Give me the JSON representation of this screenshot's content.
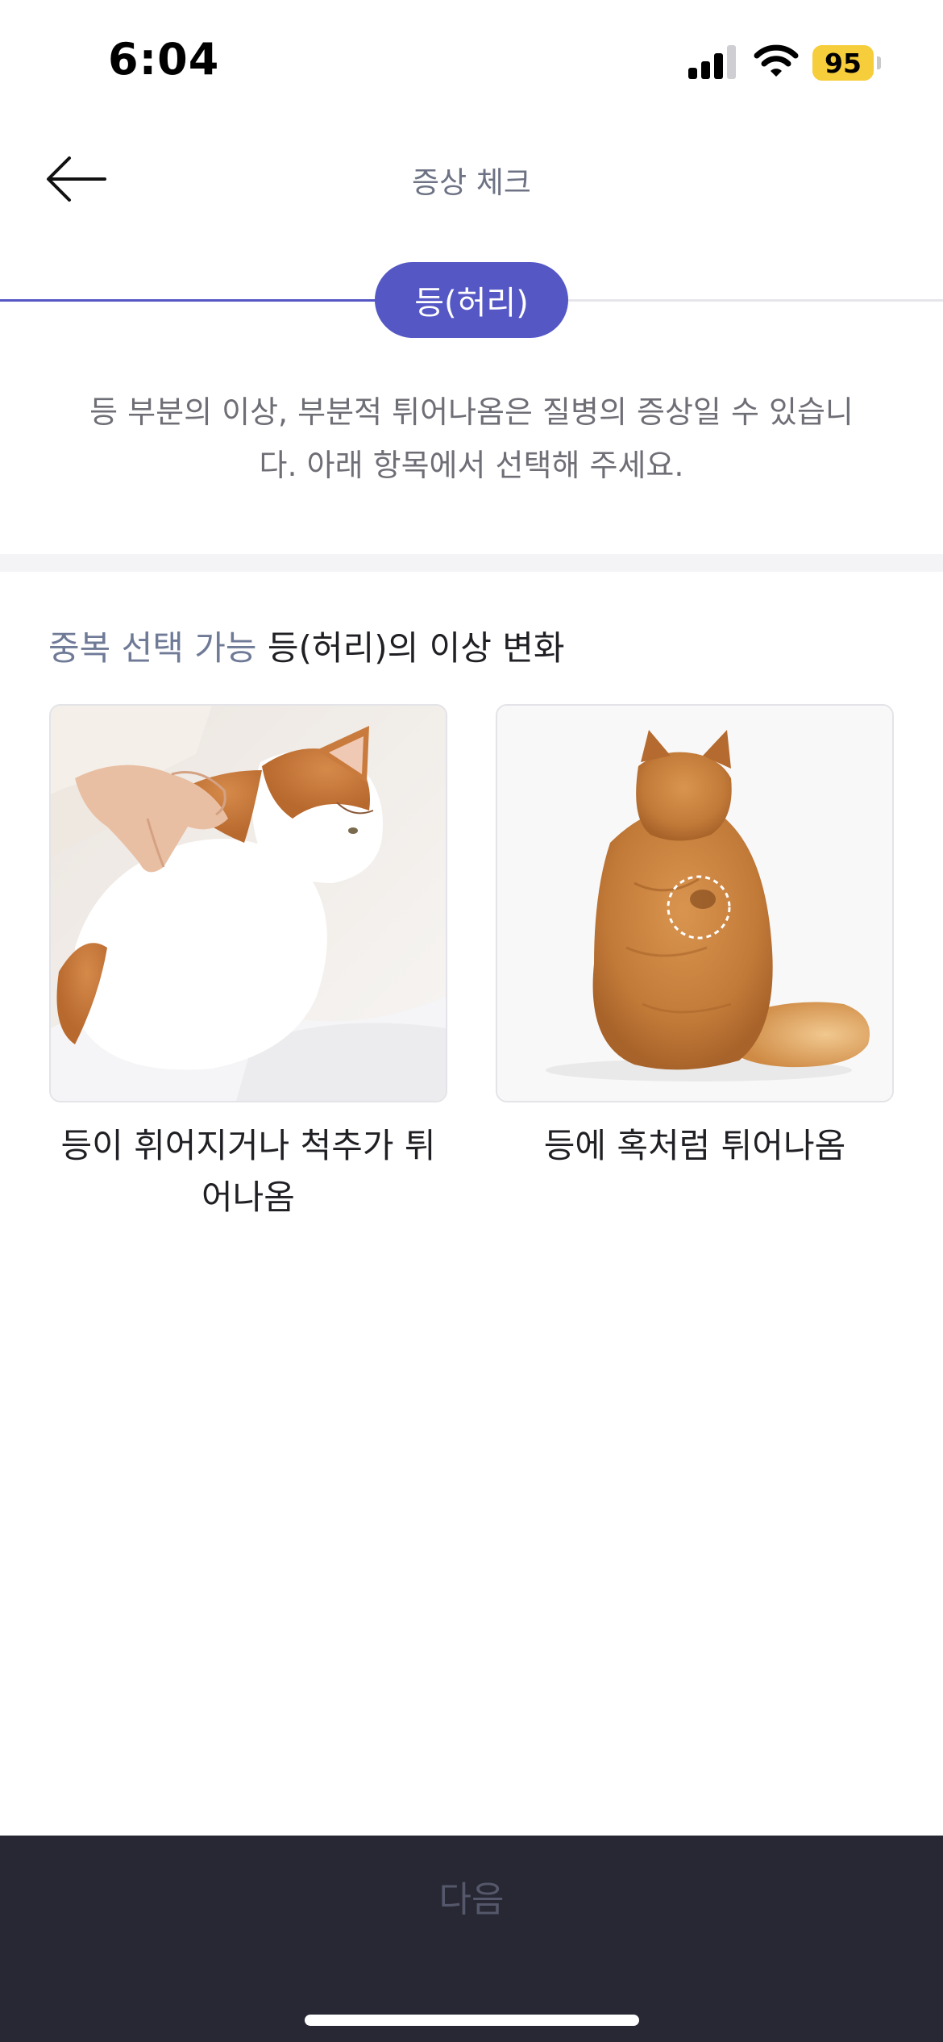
{
  "status_bar": {
    "time": "6:04",
    "battery_level": "95",
    "icons": [
      "signal-icon",
      "wifi-icon",
      "battery-icon"
    ]
  },
  "header": {
    "title": "증상 체크",
    "back_icon": "arrow-left-icon"
  },
  "stepper": {
    "current_step": "등(허리)"
  },
  "description": "등 부분의 이상, 부분적 튀어나옴은 질병의 증상일 수 있습니다. 아래 항목에서 선택해 주세요.",
  "section": {
    "badge": "중복 선택 가능",
    "title": "등(허리)의 이상 변화"
  },
  "options": [
    {
      "label": "등이 휘어지거나 척추가 튀어나옴",
      "image": "cat-being-petted-photo"
    },
    {
      "label": "등에 혹처럼 튀어나옴",
      "image": "cat-back-view-photo"
    }
  ],
  "footer": {
    "next_label": "다음"
  },
  "colors": {
    "accent": "#5457c4",
    "badge_text": "#6f7a97",
    "bottom_bar": "#272834",
    "battery": "#f6cd3a"
  }
}
